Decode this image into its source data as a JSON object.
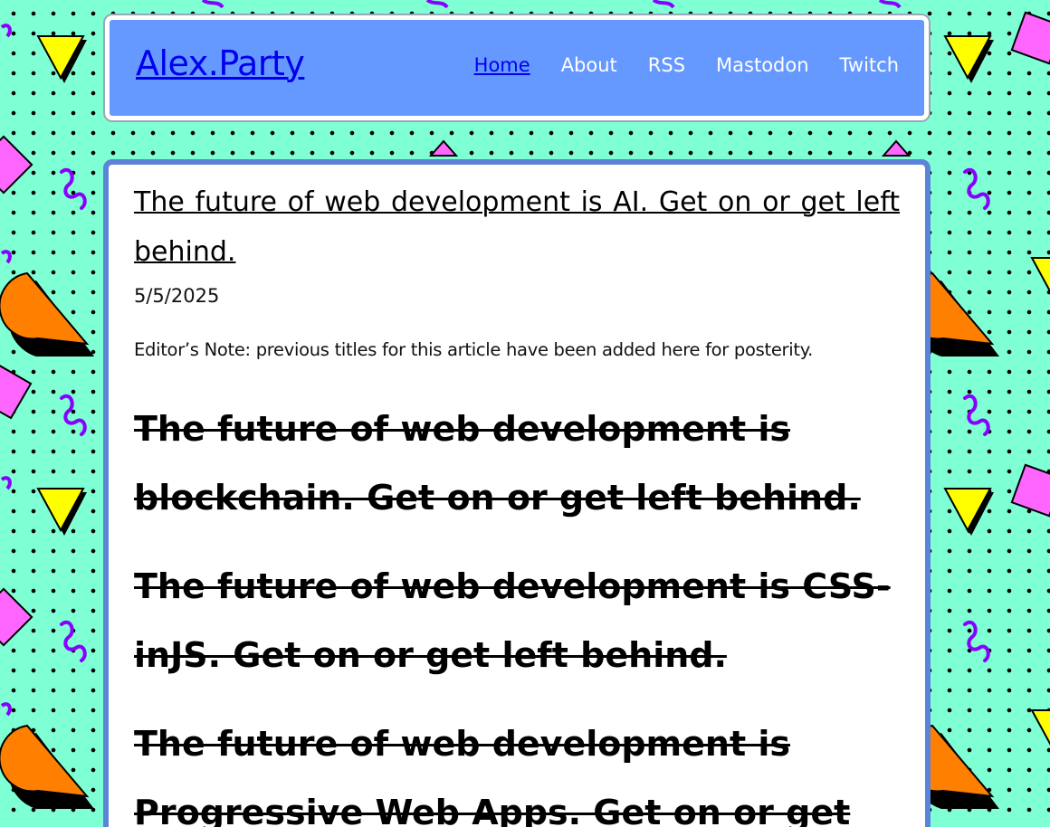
{
  "header": {
    "site_title": "Alex.Party",
    "nav": [
      {
        "label": "Home",
        "active": true
      },
      {
        "label": "About",
        "active": false
      },
      {
        "label": "RSS",
        "active": false
      },
      {
        "label": "Mastodon",
        "active": false
      },
      {
        "label": "Twitch",
        "active": false
      }
    ]
  },
  "article": {
    "title": "The future of web development is AI. Get on or get left behind.",
    "date": "5/5/2025",
    "editor_note": "Editor’s Note: previous titles for this article have been added here for posterity.",
    "previous_titles": [
      "The future of web development is blockchain. Get on or get left behind.",
      "The future of web development is CSS-inJS. Get on or get left behind.",
      "The future of web development is Progressive Web Apps. Get on or get"
    ]
  },
  "colors": {
    "background": "#7fffd4",
    "header_bg": "#6699ff",
    "link": "#0000ee",
    "article_border": "#5b84d8",
    "triangle": "#ffff00",
    "half_circle": "#ff7f00",
    "square": "#ff66ff",
    "squiggle": "#8800ff"
  },
  "icons": [
    "yellow-triangle-shape",
    "orange-half-circle-shape",
    "pink-square-shape",
    "purple-squiggle-shape"
  ]
}
